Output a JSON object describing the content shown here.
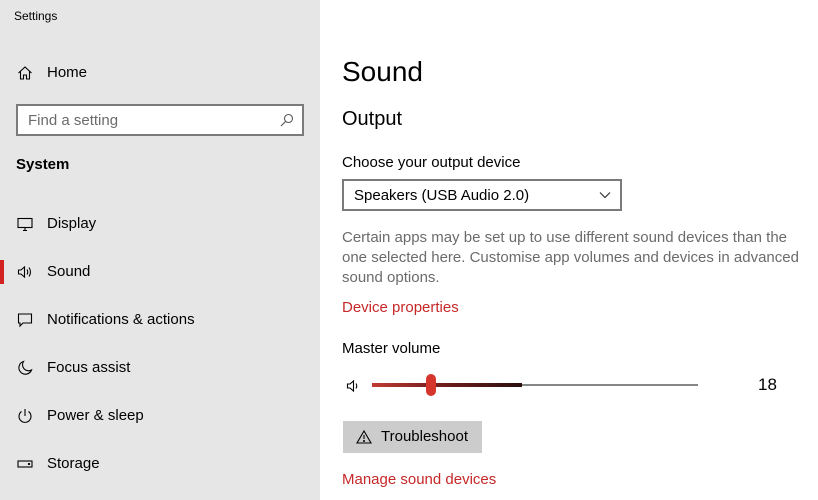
{
  "window": {
    "title": "Settings"
  },
  "sidebar": {
    "home": {
      "label": "Home",
      "icon": "home-icon"
    },
    "search": {
      "placeholder": "Find a setting",
      "icon": "search-icon"
    },
    "section_title": "System",
    "items": [
      {
        "label": "Display",
        "icon": "display-icon",
        "selected": false
      },
      {
        "label": "Sound",
        "icon": "speaker-icon",
        "selected": true
      },
      {
        "label": "Notifications & actions",
        "icon": "notification-icon",
        "selected": false
      },
      {
        "label": "Focus assist",
        "icon": "moon-icon",
        "selected": false
      },
      {
        "label": "Power & sleep",
        "icon": "power-icon",
        "selected": false
      },
      {
        "label": "Storage",
        "icon": "storage-icon",
        "selected": false
      }
    ]
  },
  "main": {
    "title": "Sound",
    "output": {
      "heading": "Output",
      "device_label": "Choose your output device",
      "device_value": "Speakers (USB Audio 2.0)",
      "description": "Certain apps may be set up to use different sound devices than the one selected here. Customise app volumes and devices in advanced sound options.",
      "device_properties_link": "Device properties",
      "volume_label": "Master volume",
      "volume_value": "18",
      "volume_fraction": 0.18,
      "volume_peak_fraction": 0.46,
      "troubleshoot_label": "Troubleshoot",
      "manage_link": "Manage sound devices"
    }
  },
  "colors": {
    "accent": "#d6352c",
    "link": "#c62828",
    "sidebar_bg": "#e6e6e6"
  }
}
